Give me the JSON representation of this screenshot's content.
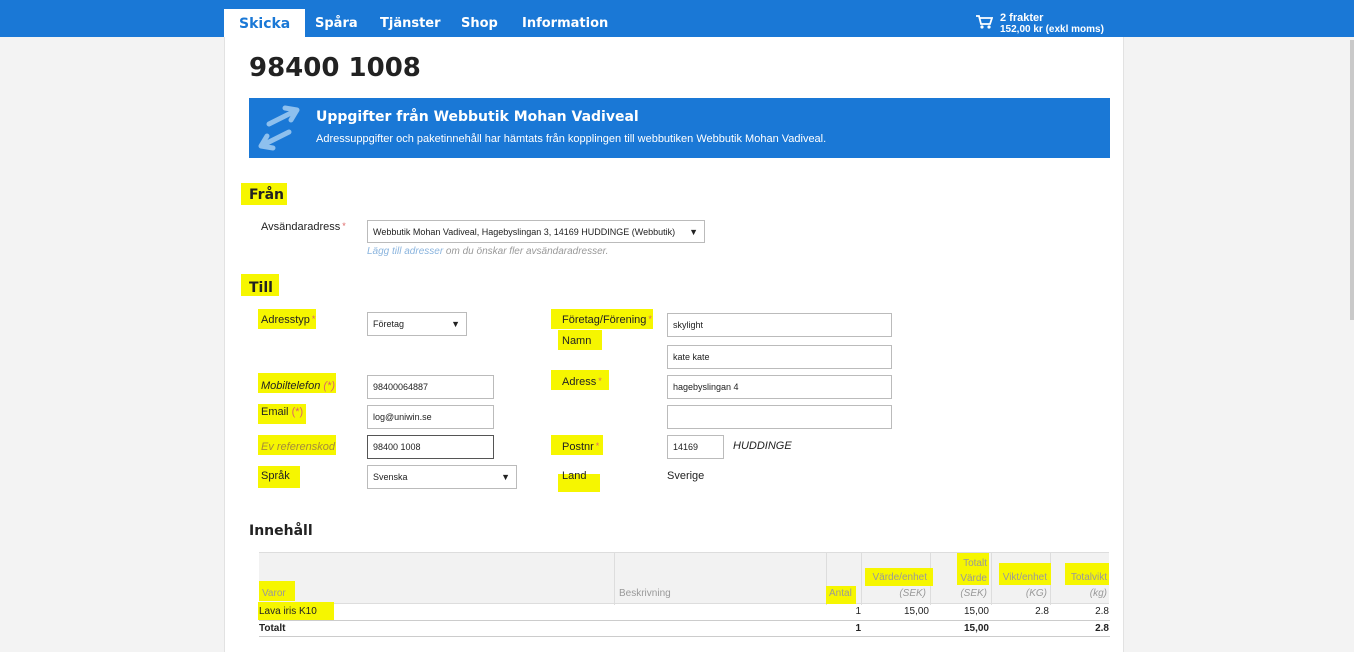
{
  "nav": {
    "tabs": [
      {
        "label": "Skicka",
        "active": true
      },
      {
        "label": "Spåra"
      },
      {
        "label": "Tjänster"
      },
      {
        "label": "Shop"
      },
      {
        "label": "Information"
      }
    ],
    "cart": {
      "icon": "shopping-cart-icon",
      "count": "2 frakter",
      "price": "152,00 kr (exkl moms)"
    }
  },
  "page": {
    "order_id": "98400 1008"
  },
  "banner": {
    "icon": "sync-arrows-icon",
    "title": "Uppgifter från Webbutik Mohan Vadiveal",
    "text": "Adressuppgifter och paketinnehåll har hämtats från kopplingen till webbutiken Webbutik Mohan Vadiveal."
  },
  "from": {
    "title": "Från",
    "sender_label": "Avsändaradress",
    "sender_value": "Webbutik Mohan Vadiveal, Hagebyslingan 3, 14169 HUDDINGE (Webbutik)",
    "hint_link": "Lägg till adresser",
    "hint_text": " om du önskar fler avsändaradresser."
  },
  "to": {
    "title": "Till",
    "address_type_label": "Adresstyp",
    "address_type_value": "Företag",
    "company_label": "Företag/Förening",
    "company_value": "skylight",
    "name_label": "Namn",
    "name_value": "kate kate",
    "mobile_label": "Mobiltelefon",
    "mobile_req": "(*)",
    "mobile_value": "98400064887",
    "address_label": "Adress",
    "address_value": "hagebyslingan 4",
    "address2_value": "",
    "email_label": "Email",
    "email_req": "(*)",
    "email_value": "log@uniwin.se",
    "ref_label": "Ev referenskod",
    "ref_value": "98400 1008",
    "postnr_label": "Postnr",
    "postnr_value": "14169",
    "city_value": "HUDDINGE",
    "language_label": "Språk",
    "language_value": "Svenska",
    "country_label": "Land",
    "country_value": "Sverige"
  },
  "content": {
    "title": "Innehåll",
    "headers": {
      "items": "Varor",
      "description": "Beskrivning",
      "qty": "Antal",
      "unit_value": "Värde/enhet",
      "unit_value_unit": "(SEK)",
      "total_value_1": "Totalt",
      "total_value_2": "Värde",
      "total_value_unit": "(SEK)",
      "unit_weight": "Vikt/enhet",
      "unit_weight_unit": "(KG)",
      "total_weight": "Totalvikt",
      "total_weight_unit": "(kg)"
    },
    "rows": [
      {
        "item": "Lava iris K10",
        "description": "",
        "qty": "1",
        "unit_value": "15,00",
        "total_value": "15,00",
        "unit_weight": "2.8",
        "total_weight": "2.8"
      }
    ],
    "total": {
      "label": "Totalt",
      "qty": "1",
      "total_value": "15,00",
      "total_weight": "2.8"
    }
  },
  "colors": {
    "brand": "#1a78d6",
    "highlight": "#f6f600"
  }
}
